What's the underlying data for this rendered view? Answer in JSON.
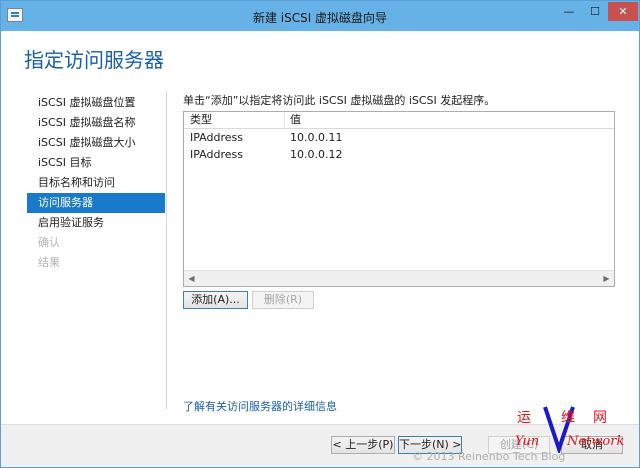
{
  "window": {
    "title": "新建 iSCSI 虚拟磁盘向导",
    "controls": {
      "minimize": "—",
      "maximize": "☐",
      "close": "✕"
    }
  },
  "page": {
    "title": "指定访问服务器"
  },
  "nav": {
    "items": [
      {
        "label": "iSCSI 虚拟磁盘位置",
        "state": "normal"
      },
      {
        "label": "iSCSI 虚拟磁盘名称",
        "state": "normal"
      },
      {
        "label": "iSCSI 虚拟磁盘大小",
        "state": "normal"
      },
      {
        "label": "iSCSI 目标",
        "state": "normal"
      },
      {
        "label": "目标名称和访问",
        "state": "normal"
      },
      {
        "label": "访问服务器",
        "state": "active"
      },
      {
        "label": "启用验证服务",
        "state": "normal"
      },
      {
        "label": "确认",
        "state": "disabled"
      },
      {
        "label": "结果",
        "state": "disabled"
      }
    ]
  },
  "main": {
    "instruction": "单击“添加”以指定将访问此 iSCSI 虚拟磁盘的 iSCSI 发起程序。",
    "grid": {
      "columns": [
        "类型",
        "值"
      ],
      "rows": [
        [
          "IPAddress",
          "10.0.0.11"
        ],
        [
          "IPAddress",
          "10.0.0.12"
        ]
      ]
    },
    "add_button": "添加(A)...",
    "remove_button": "删除(R)",
    "more_info_link": "了解有关访问服务器的详细信息"
  },
  "footer": {
    "prev": "< 上一步(P)",
    "next": "下一步(N) >",
    "create": "创建(C)",
    "cancel": "取消"
  },
  "watermark": {
    "logo_chars": [
      "运",
      "维",
      "网"
    ],
    "logo_word_left": "Yun",
    "logo_word_right": "Network",
    "text": "© 2013 Reinenbo Tech Blog"
  },
  "colors": {
    "titlebar": "#66b1e6",
    "accent": "#1979ca",
    "heading": "#1a5fa8",
    "close": "#c75050",
    "watermark_red": "#e8141a",
    "watermark_blue": "#1a1ac8"
  }
}
